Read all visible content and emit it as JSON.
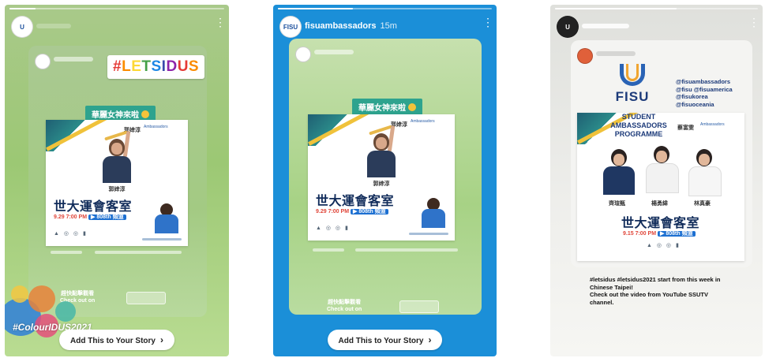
{
  "stories": [
    {
      "id": "story1",
      "progress": 0.12,
      "background": "#a5ca84",
      "header": {
        "avatar_text": "U"
      },
      "sticker": {
        "hashtag_letters": [
          "#",
          "L",
          "E",
          "T",
          "S",
          "I",
          "D",
          "U",
          "S"
        ],
        "colors": [
          "#e53935",
          "#fb8c00",
          "#fdd835",
          "#43a047",
          "#1e88e5",
          "#3949ab",
          "#8e24aa",
          "#e53935",
          "#fb8c00"
        ]
      },
      "repost": {
        "tag": "華麗女神來啦",
        "poster": {
          "title": "世大運會客室",
          "date": "9.29  7:00 PM",
          "chip": "▶ 808th 頻道",
          "athlete_name": "郭婞淳"
        }
      },
      "checkout": {
        "line1": "趕快點擊觀看",
        "line2": "Check out on"
      },
      "footer_tag": "#ColourIDUS2021",
      "cta": "Add This to Your Story"
    },
    {
      "id": "story2",
      "progress": 0.35,
      "background": "#1b8fd8",
      "header": {
        "avatar_text": "FISU",
        "name": "fisuambassadors",
        "time": "15m"
      },
      "repost": {
        "tag": "華麗女神來啦",
        "poster": {
          "title": "世大運會客室",
          "date": "9.29  7:00 PM",
          "chip": "▶ 808th 頻道",
          "athlete_name": "郭婞淳"
        }
      },
      "checkout": {
        "line1": "趕快點擊觀看",
        "line2": "Check out on"
      },
      "cta": "Add This to Your Story"
    },
    {
      "id": "story3",
      "progress": 0.6,
      "background": "#e8e8e5",
      "header": {
        "avatar_text": "U"
      },
      "repost": {
        "fisu_word": "FISU",
        "handles": [
          "@fisuambassadors",
          "@fisu @fisuamerica",
          "@fisukorea",
          "@fisuoceania"
        ],
        "programme": [
          "STUDENT",
          "AMBASSADORS",
          "PROGRAMME"
        ],
        "poster": {
          "title": "世大運會客室",
          "date": "9.15  7:00 PM",
          "chip": "▶ 808th 頻道",
          "host_name": "蔡富雯"
        },
        "people": [
          "齊瑄甄",
          "楊勇緯",
          "林真豪"
        ]
      },
      "caption": [
        "#letsidus #letsidus2021 start from this week in",
        "Chinese Taipei!",
        "Check out the video from YouTube SSUTV",
        "channel."
      ]
    }
  ]
}
